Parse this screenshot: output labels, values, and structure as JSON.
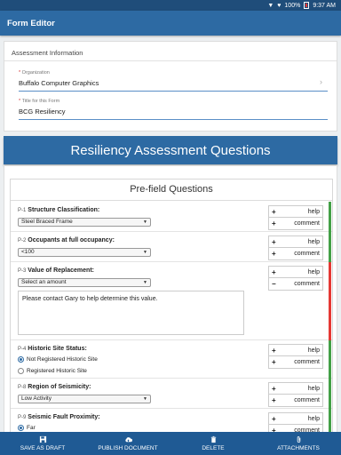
{
  "status": {
    "battery": "100%",
    "time": "9:37 AM",
    "colors": {
      "battery": "#e53935"
    }
  },
  "appbar": {
    "title": "Form Editor"
  },
  "assessment": {
    "header": "Assessment Information",
    "organization": {
      "label": "Organization",
      "value": "Buffalo Computer Graphics"
    },
    "form_title": {
      "label": "Title for this Form",
      "value": "BCG Resiliency"
    }
  },
  "banner": "Resiliency Assessment Questions",
  "prefield": {
    "title": "Pre-field Questions",
    "help_label": "help",
    "comment_label": "comment",
    "q1": {
      "num": "P-1",
      "text": "Structure Classification:",
      "selected": "Steel Braced Frame",
      "indicator": "#43a047"
    },
    "q2": {
      "num": "P-2",
      "text": "Occupants at full occupancy:",
      "selected": "<100",
      "indicator": "#43a047"
    },
    "q3": {
      "num": "P-3",
      "text": "Value of Replacement:",
      "selected": "Select an amount",
      "comment_text": "Please contact Gary to help determine this value.",
      "indicator": "#e53935"
    },
    "q4": {
      "num": "P-4",
      "text": "Historic Site Status:",
      "options": [
        "Not Registered Historic Site",
        "Registered Historic Site"
      ],
      "indicator": "#43a047"
    },
    "q5": {
      "num": "P-8",
      "text": "Region of Seismicity:",
      "selected": "Low Activity",
      "indicator": "#43a047"
    },
    "q6": {
      "num": "P-9",
      "text": "Seismic Fault Proximity:",
      "option": "Far",
      "indicator": "#43a047"
    }
  },
  "bottom": {
    "save": "SAVE AS DRAFT",
    "publish": "PUBLISH DOCUMENT",
    "delete": "DELETE",
    "attachments": "ATTACHMENTS"
  }
}
